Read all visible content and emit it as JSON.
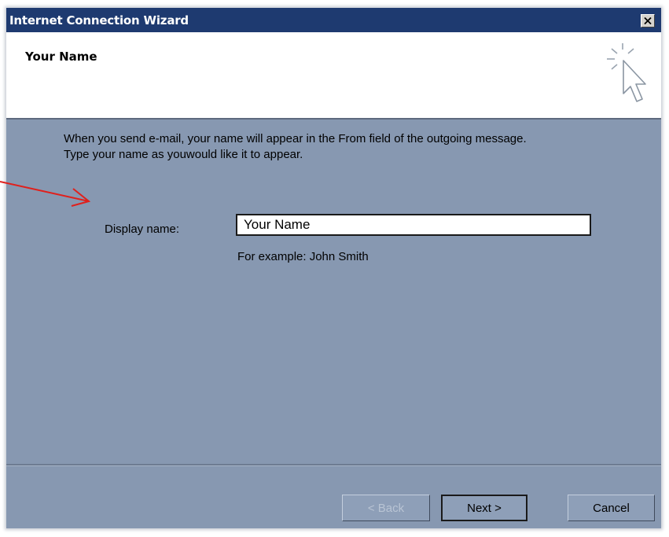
{
  "window": {
    "title": "Internet Connection Wizard",
    "close_icon": "close-icon"
  },
  "header": {
    "title": "Your Name",
    "icon": "wizard-cursor-icon"
  },
  "content": {
    "description_line1": "When you send e-mail, your name will appear in the From field of the outgoing message.",
    "description_line2": "Type your name as youwould like it to appear.",
    "display_name_label": "Display name:",
    "display_name_value": "Your Name",
    "example_text": "For example: John Smith"
  },
  "buttons": {
    "back_label": "< Back",
    "next_label": "Next >",
    "cancel_label": "Cancel"
  },
  "annotation": {
    "arrow_color": "#e0201c"
  },
  "colors": {
    "titlebar": "#1e3a70",
    "panel": "#8798b1"
  }
}
